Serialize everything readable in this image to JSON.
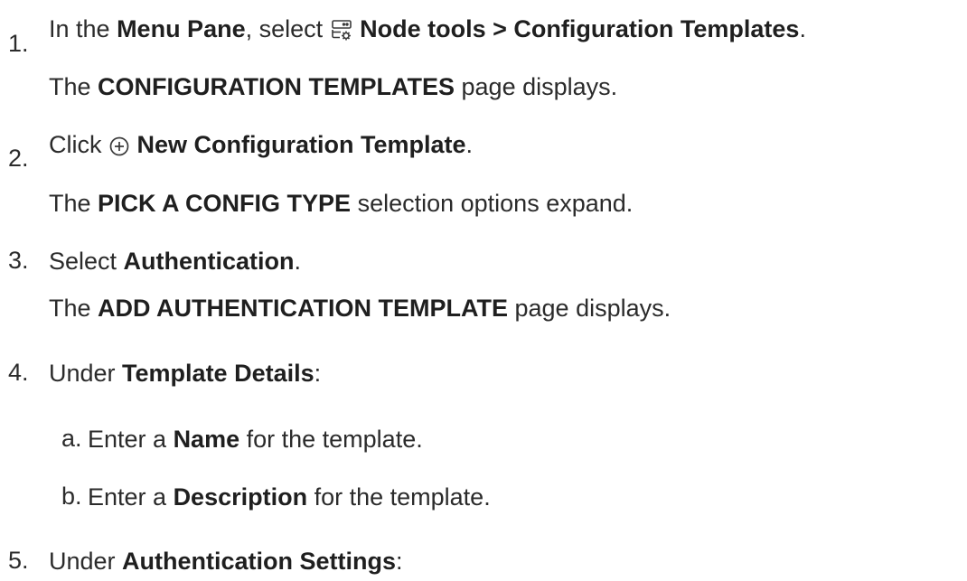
{
  "steps": [
    {
      "number": "1.",
      "instruction": {
        "t1": "In the ",
        "b1": "Menu Pane",
        "t2": ", select ",
        "icon": "server-gear-icon",
        "b2": "Node tools > Configuration Templates",
        "t3": "."
      },
      "result": {
        "t1": "The ",
        "b1": "CONFIGURATION TEMPLATES",
        "t2": " page displays."
      }
    },
    {
      "number": "2.",
      "instruction": {
        "t1": "Click ",
        "icon": "plus-circle-icon",
        "b1": "New Configuration Template",
        "t2": "."
      },
      "result": {
        "t1": "The ",
        "b1": "PICK A CONFIG TYPE",
        "t2": " selection options expand."
      }
    },
    {
      "number": "3.",
      "instruction": {
        "t1": "Select ",
        "b1": "Authentication",
        "t2": "."
      },
      "result": {
        "t1": "The ",
        "b1": "ADD AUTHENTICATION TEMPLATE",
        "t2": " page displays."
      }
    },
    {
      "number": "4.",
      "instruction": {
        "t1": "Under ",
        "b1": "Template Details",
        "t2": ":"
      },
      "substeps": [
        {
          "letter": "a.",
          "t1": "Enter a ",
          "b1": "Name",
          "t2": " for the template."
        },
        {
          "letter": "b.",
          "t1": "Enter a ",
          "b1": "Description",
          "t2": " for the template."
        }
      ]
    },
    {
      "number": "5.",
      "instruction": {
        "t1": "Under ",
        "b1": "Authentication Settings",
        "t2": ":"
      }
    }
  ]
}
